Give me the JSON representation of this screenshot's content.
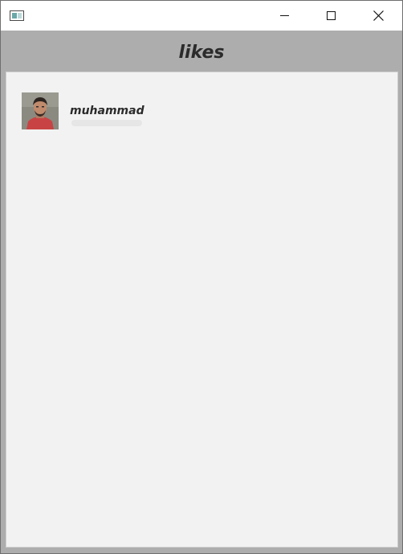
{
  "window": {
    "icons": {
      "app": "app-window-icon",
      "minimize": "minimize-icon",
      "maximize": "maximize-icon",
      "close": "close-icon"
    }
  },
  "header": {
    "title": "likes"
  },
  "likes": [
    {
      "name": "muhammad",
      "avatar": "user-avatar-photo"
    }
  ],
  "colors": {
    "header_bg": "#adadad",
    "panel_bg": "#f2f2f2",
    "text": "#2b2b2b"
  }
}
